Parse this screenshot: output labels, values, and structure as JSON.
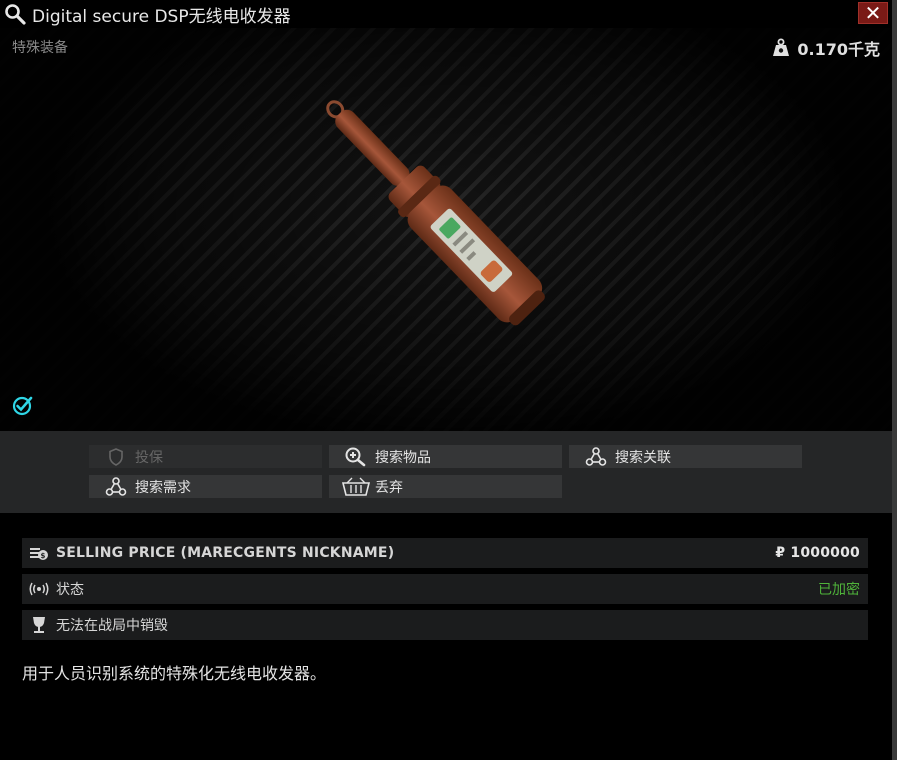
{
  "window": {
    "title": "Digital secure DSP无线电收发器",
    "close_label": "✕"
  },
  "item": {
    "category": "特殊装备",
    "weight": "0.170千克"
  },
  "actions": {
    "insure": "投保",
    "search_item": "搜索物品",
    "search_links": "搜索关联",
    "search_requirements": "搜索需求",
    "discard": "丢弃"
  },
  "info": {
    "selling_price_label": "SELLING PRICE (MARECGENTS NICKNAME)",
    "selling_price_value": "₽ 1000000",
    "status_label": "状态",
    "status_value": "已加密",
    "indestructible_label": "无法在战局中销毁"
  },
  "description": "用于人员识别系统的特殊化无线电收发器。",
  "icons": {
    "title": "search-icon",
    "weight": "weight-icon",
    "found": "found-in-raid-icon",
    "insure": "shield-icon",
    "search_item": "magnifier-plus-icon",
    "search_links": "linked-nodes-icon",
    "search_requirements": "linked-nodes-icon",
    "discard": "trash-basket-icon",
    "price": "money-stack-icon",
    "status": "radio-signal-icon",
    "indestructible": "trophy-cup-icon"
  },
  "colors": {
    "close_button": "#7a1a16",
    "status_encrypted": "#4fb43a",
    "found_icon": "#2fd6e6",
    "item_body": "#9a4a2a"
  }
}
